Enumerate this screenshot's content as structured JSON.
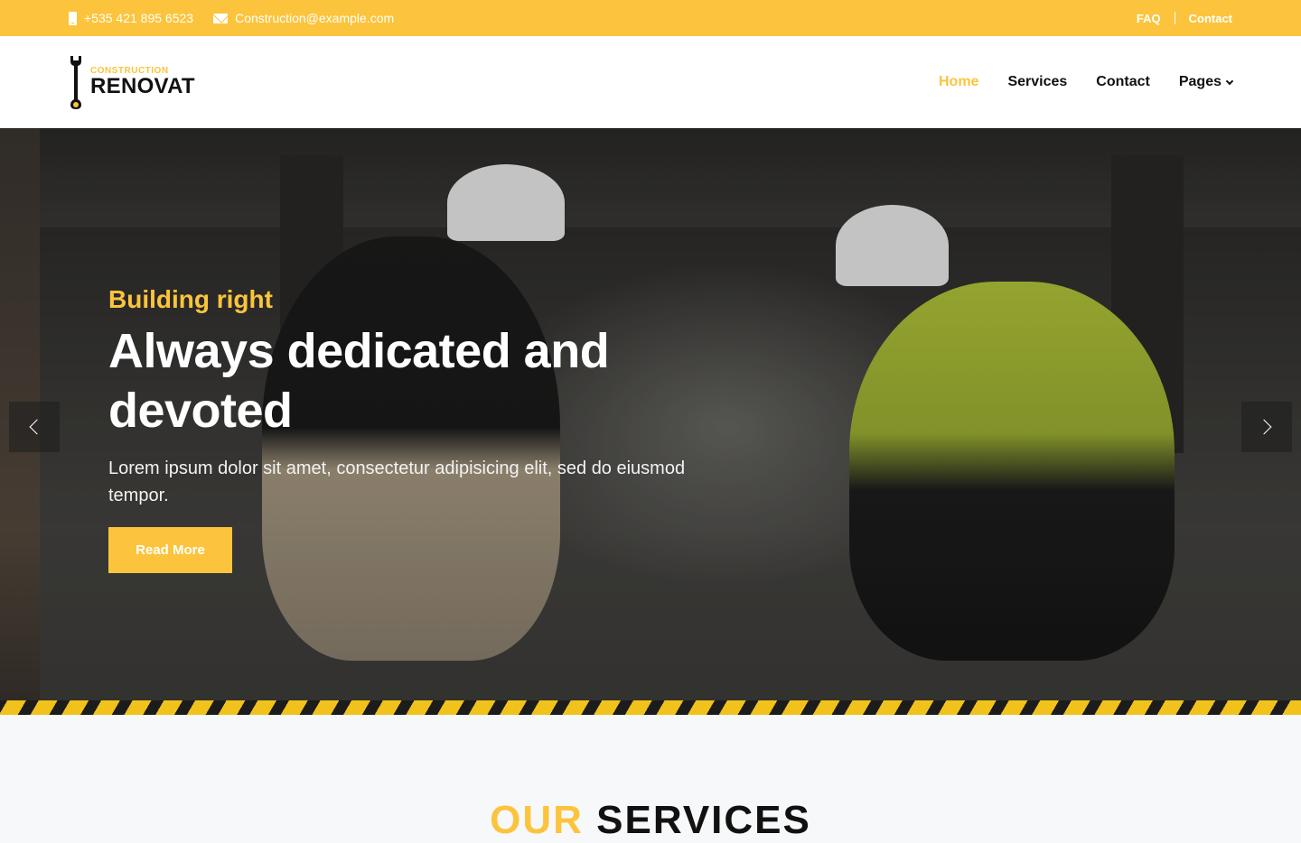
{
  "topbar": {
    "phone": "+535 421 895 6523",
    "email": "Construction@example.com",
    "links": [
      "FAQ",
      "Contact"
    ]
  },
  "header": {
    "logo_small": "CONSTRUCTION",
    "logo_big": "RENOVAT",
    "nav": [
      {
        "label": "Home",
        "active": true
      },
      {
        "label": "Services",
        "active": false
      },
      {
        "label": "Contact",
        "active": false
      },
      {
        "label": "Pages",
        "active": false,
        "dropdown": true
      }
    ]
  },
  "hero": {
    "subtitle": "Building right",
    "title": "Always dedicated and devoted",
    "description": "Lorem ipsum dolor sit amet, consectetur adipisicing elit, sed do eiusmod tempor.",
    "button": "Read More"
  },
  "services": {
    "heading_accent": "OUR",
    "heading_rest": "SERVICES"
  },
  "colors": {
    "accent": "#fcc43c",
    "dark": "#111111"
  }
}
